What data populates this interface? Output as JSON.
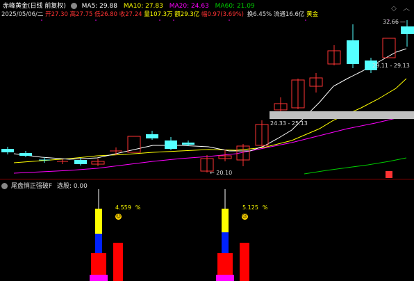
{
  "header": {
    "stock_name": "赤峰黄金(日线 前复权)",
    "ma5": "MA5: 29.88",
    "ma10": "MA10: 27.83",
    "ma20": "MA20: 24.63",
    "ma60": "MA60: 21.09",
    "ma_colors": {
      "ma5": "#ffffff",
      "ma10": "#ffff00",
      "ma20": "#ff00ff",
      "ma60": "#00cc00"
    }
  },
  "quote": {
    "date": "2025/05/06/二",
    "open": "开27.30",
    "high": "高27.75",
    "low": "低26.80",
    "close": "收27.24",
    "volume": "量107.3万",
    "amount": "额29.3亿",
    "change": "幅0.97(3.69%)",
    "turnover": "换6.45%",
    "float_cap": "流通16.6亿",
    "sector": "黄金"
  },
  "price_labels": {
    "high_mark": "32.66",
    "range_a": "29.11 - 29.13",
    "range_b": "24.33 - 25.13",
    "low_mark": "20.10"
  },
  "indicator": {
    "title": "尾盘悄正强破F",
    "select": "选股: 0.00",
    "value_a": "4.559",
    "value_b": "5.125",
    "pct": "%"
  },
  "icons": {
    "main_settings": "gear-icon",
    "sub_settings": "gear-icon",
    "window_controls": "diamond-icon"
  }
}
